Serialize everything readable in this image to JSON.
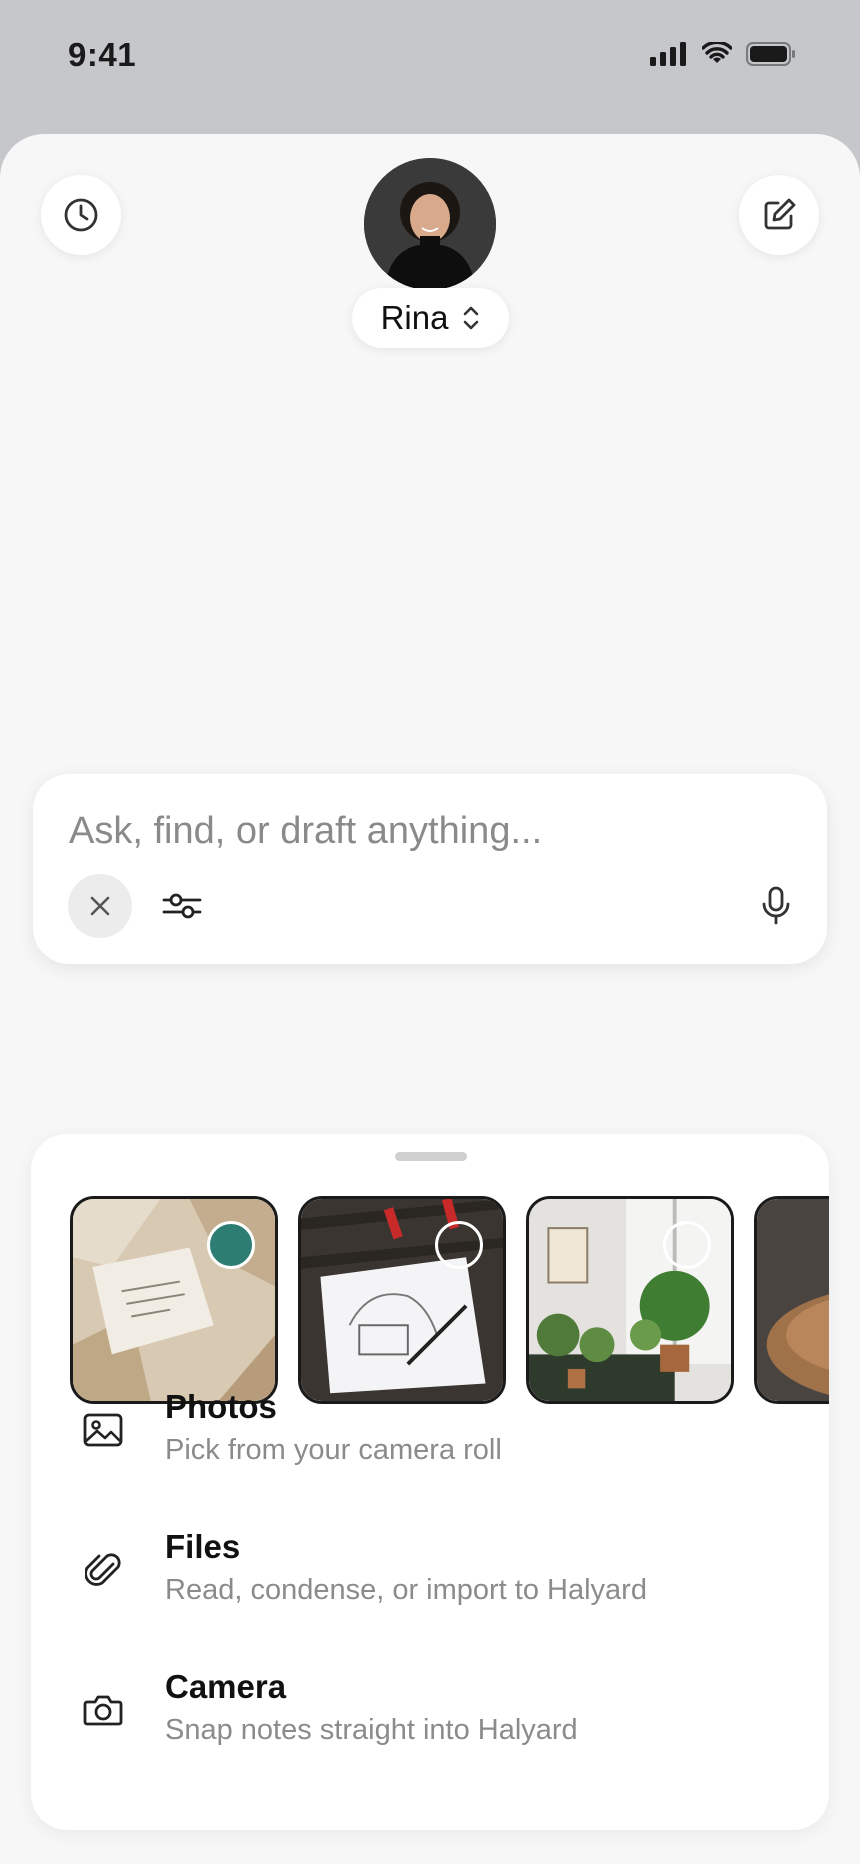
{
  "status_bar": {
    "time": "9:41"
  },
  "header": {
    "history_icon": "clock-icon",
    "compose_icon": "compose-icon",
    "profile_name": "Rina",
    "profile_switch_icon": "chevron-updown-icon"
  },
  "composer": {
    "placeholder": "Ask, find, or draft anything...",
    "close_icon": "close-icon",
    "filter_icon": "sliders-icon",
    "mic_icon": "microphone-icon"
  },
  "attachments": {
    "photos_row": [
      {
        "name": "paper-note-photo",
        "selected": true
      },
      {
        "name": "sketch-drawing-photo",
        "selected": false
      },
      {
        "name": "plants-room-photo",
        "selected": false
      },
      {
        "name": "table-photo",
        "selected": false
      }
    ],
    "options": [
      {
        "icon": "image-icon",
        "title": "Photos",
        "subtitle": "Pick from your camera roll"
      },
      {
        "icon": "paperclip-icon",
        "title": "Files",
        "subtitle": "Read, condense, or import to Halyard"
      },
      {
        "icon": "camera-icon",
        "title": "Camera",
        "subtitle": "Snap notes straight into Halyard"
      }
    ]
  },
  "colors": {
    "selected_accent": "#2e7d72",
    "background": "#f7f7f7",
    "status_bg": "#c5c7cb"
  }
}
